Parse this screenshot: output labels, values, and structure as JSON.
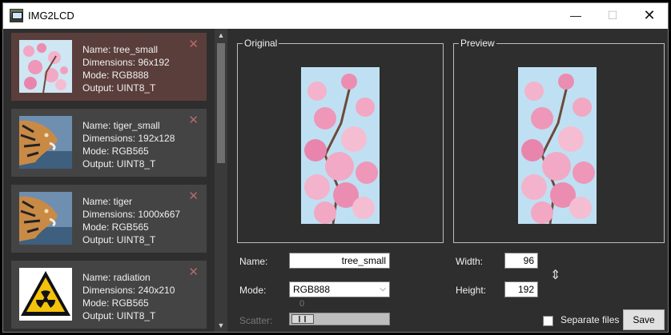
{
  "window": {
    "title": "IMG2LCD",
    "min_symbol": "—",
    "max_symbol": "☐",
    "close_symbol": "✕"
  },
  "image_list": {
    "items": [
      {
        "name": "Name: tree_small",
        "dimensions": "Dimensions: 96x192",
        "mode": "Mode: RGB888",
        "output": "Output: UINT8_T",
        "thumb": "blossom",
        "selected": true
      },
      {
        "name": "Name: tiger_small",
        "dimensions": "Dimensions: 192x128",
        "mode": "Mode: RGB565",
        "output": "Output: UINT8_T",
        "thumb": "tiger",
        "selected": false
      },
      {
        "name": "Name: tiger",
        "dimensions": "Dimensions: 1000x667",
        "mode": "Mode: RGB565",
        "output": "Output: UINT8_T",
        "thumb": "tiger",
        "selected": false
      },
      {
        "name": "Name: radiation",
        "dimensions": "Dimensions: 240x210",
        "mode": "Mode: RGB565",
        "output": "Output: UINT8_T",
        "thumb": "radiation",
        "selected": false
      }
    ],
    "remove_symbol": "✕",
    "scroll_up": "▲",
    "scroll_down": "▼"
  },
  "original": {
    "label": "Original"
  },
  "preview": {
    "label": "Preview"
  },
  "form": {
    "name_label": "Name:",
    "name_value": "tree_small",
    "mode_label": "Mode:",
    "mode_value": "RGB888",
    "mode_caret": "⌵",
    "scatter_label": "Scatter:",
    "scatter_value": "0",
    "width_label": "Width:",
    "width_value": "96",
    "height_label": "Height:",
    "height_value": "192",
    "link_symbol": "⇕",
    "separate_files_label": "Separate files",
    "separate_files_checked": false,
    "save_label": "Save"
  },
  "colors": {
    "selected_card": "#5a3e3b",
    "card": "#444444",
    "window_bg": "#2e2e2e",
    "remove_x": "#b56a6a"
  }
}
